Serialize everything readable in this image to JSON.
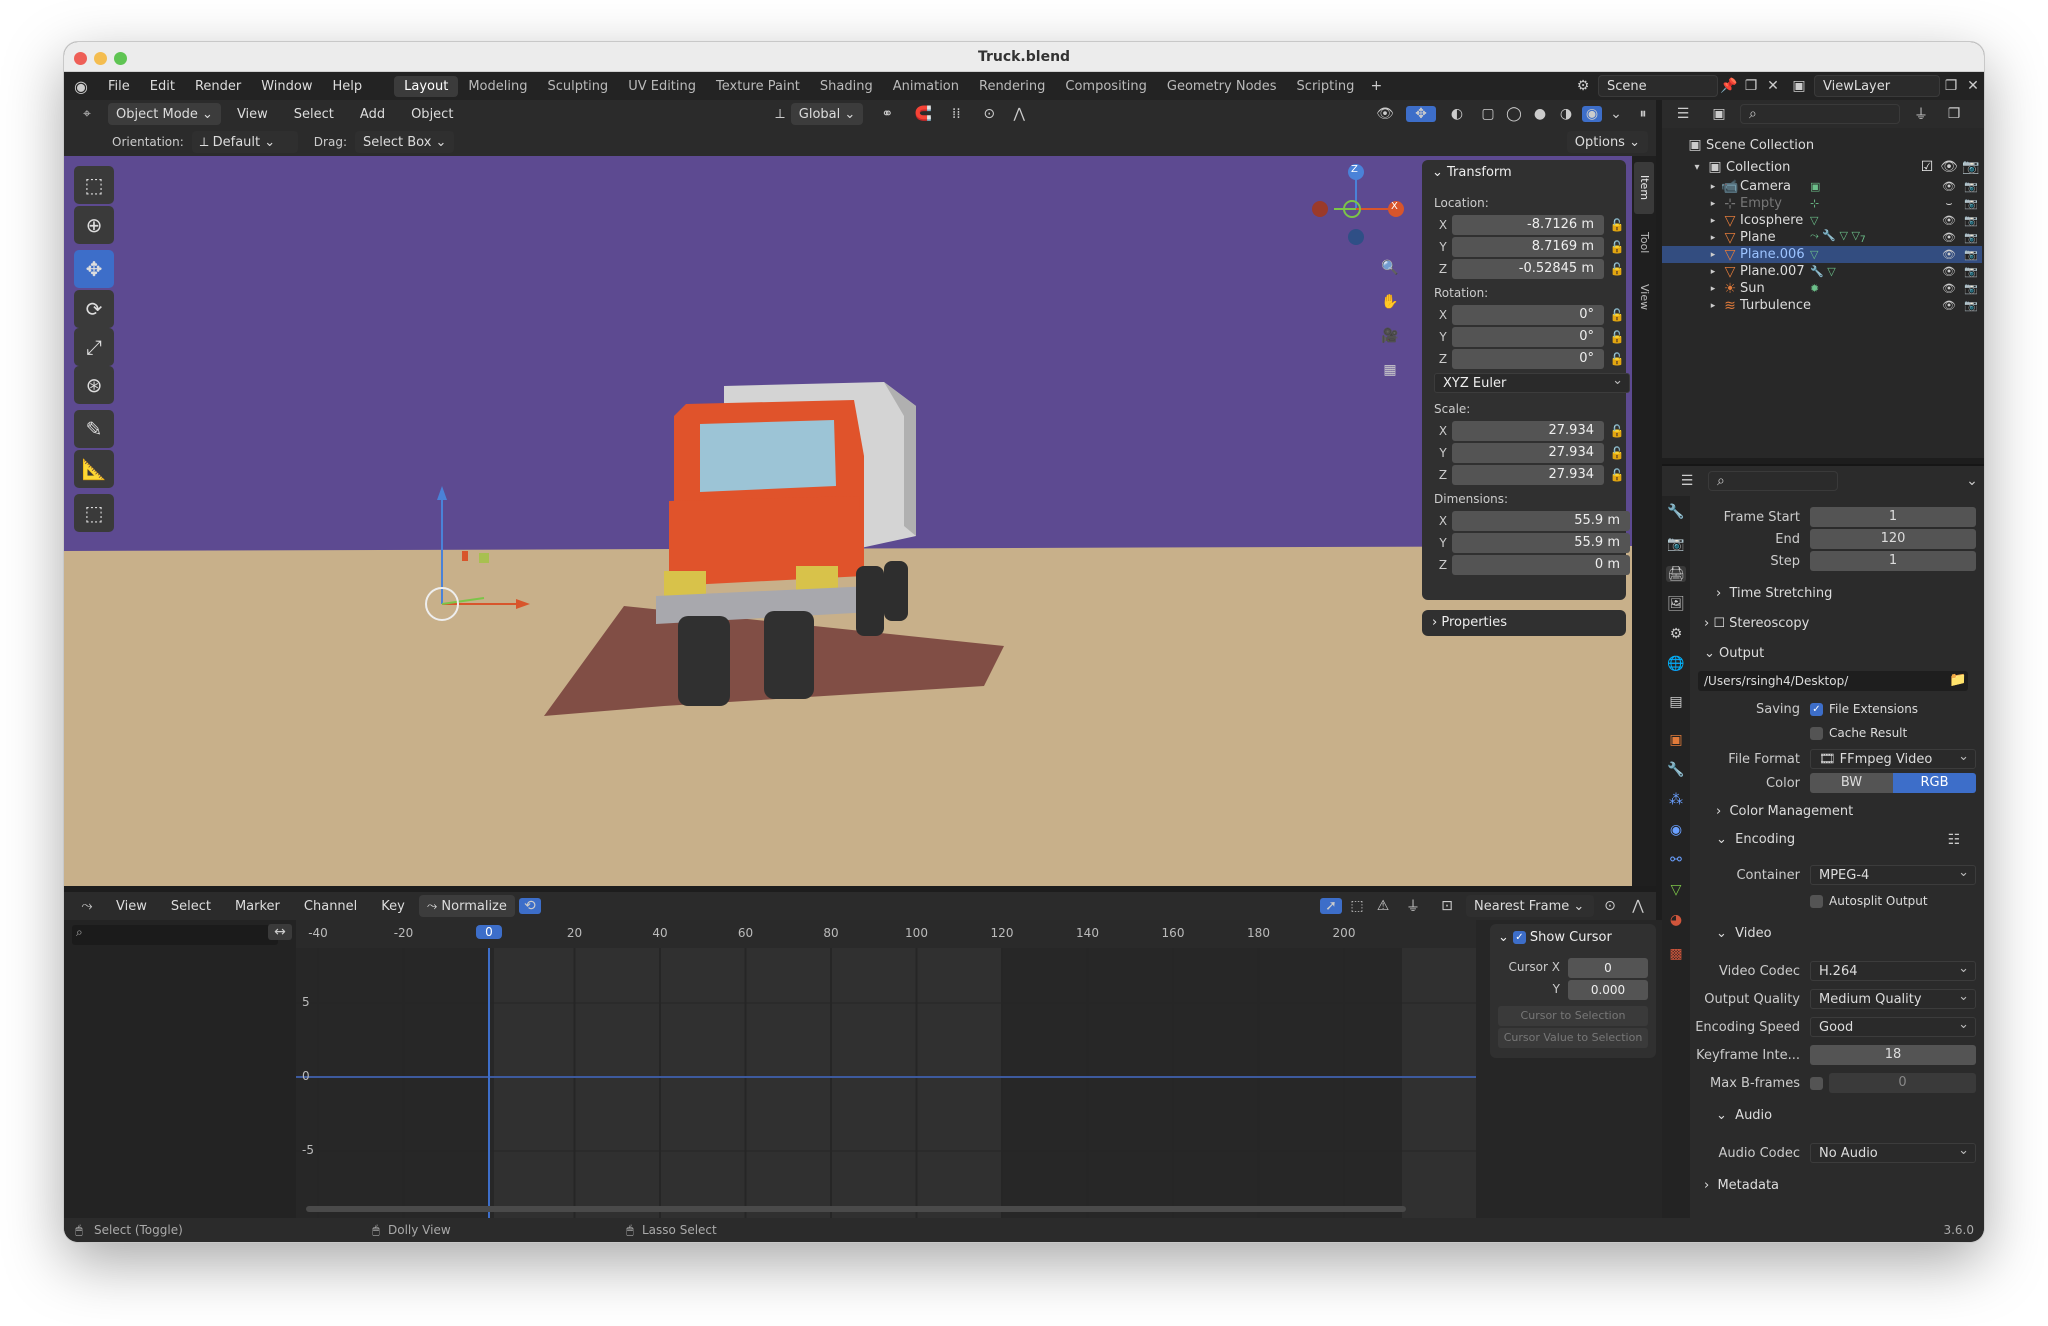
{
  "window": {
    "title": "Truck.blend"
  },
  "menu": [
    "File",
    "Edit",
    "Render",
    "Window",
    "Help"
  ],
  "workspaces": [
    "Layout",
    "Modeling",
    "Sculpting",
    "UV Editing",
    "Texture Paint",
    "Shading",
    "Animation",
    "Rendering",
    "Compositing",
    "Geometry Nodes",
    "Scripting"
  ],
  "active_workspace": "Layout",
  "scene": {
    "scene_name": "Scene",
    "view_layer": "ViewLayer"
  },
  "viewport_header": {
    "mode": "Object Mode",
    "menus": [
      "View",
      "Select",
      "Add",
      "Object"
    ],
    "transform_orientation": "Global",
    "orientation_label": "Orientation:",
    "orientation_value": "Default",
    "drag_label": "Drag:",
    "drag_value": "Select Box",
    "options": "Options"
  },
  "sidebar_tabs": [
    "Item",
    "Tool",
    "View"
  ],
  "transform_panel": {
    "title": "Transform",
    "location_label": "Location:",
    "location": [
      {
        "axis": "X",
        "value": "-8.7126 m"
      },
      {
        "axis": "Y",
        "value": "8.7169 m"
      },
      {
        "axis": "Z",
        "value": "-0.52845 m"
      }
    ],
    "rotation_label": "Rotation:",
    "rotation": [
      {
        "axis": "X",
        "value": "0°"
      },
      {
        "axis": "Y",
        "value": "0°"
      },
      {
        "axis": "Z",
        "value": "0°"
      }
    ],
    "rotation_mode": "XYZ Euler",
    "scale_label": "Scale:",
    "scale": [
      {
        "axis": "X",
        "value": "27.934"
      },
      {
        "axis": "Y",
        "value": "27.934"
      },
      {
        "axis": "Z",
        "value": "27.934"
      }
    ],
    "dimensions_label": "Dimensions:",
    "dimensions": [
      {
        "axis": "X",
        "value": "55.9 m"
      },
      {
        "axis": "Y",
        "value": "55.9 m"
      },
      {
        "axis": "Z",
        "value": "0 m"
      }
    ],
    "properties_title": "Properties"
  },
  "gizmo": {
    "x": "X",
    "y": "Y",
    "z": "Z"
  },
  "outliner": {
    "root": "Scene Collection",
    "collection": "Collection",
    "items": [
      {
        "name": "Camera",
        "color": "#e0773f"
      },
      {
        "name": "Empty",
        "color": "#777777"
      },
      {
        "name": "Icosphere",
        "color": "#e07a3a"
      },
      {
        "name": "Plane",
        "color": "#e07a3a"
      },
      {
        "name": "Plane.006",
        "color": "#e07a3a"
      },
      {
        "name": "Plane.007",
        "color": "#e07a3a"
      },
      {
        "name": "Sun",
        "color": "#e07a3a"
      },
      {
        "name": "Turbulence",
        "color": "#e07a3a"
      }
    ],
    "selected": "Plane.006",
    "plane_badge": "7"
  },
  "properties": {
    "frame_start_label": "Frame Start",
    "frame_start": "1",
    "end_label": "End",
    "end": "120",
    "step_label": "Step",
    "step": "1",
    "time_stretching": "Time Stretching",
    "stereoscopy": "Stereoscopy",
    "output": "Output",
    "path": "/Users/rsingh4/Desktop/",
    "saving_label": "Saving",
    "file_extensions": "File Extensions",
    "cache_result": "Cache Result",
    "file_format_label": "File Format",
    "file_format": "FFmpeg Video",
    "color_label": "Color",
    "color_bw": "BW",
    "color_rgb": "RGB",
    "color_management": "Color Management",
    "encoding": "Encoding",
    "container_label": "Container",
    "container": "MPEG-4",
    "autosplit": "Autosplit Output",
    "video": "Video",
    "video_codec_label": "Video Codec",
    "video_codec": "H.264",
    "output_quality_label": "Output Quality",
    "output_quality": "Medium Quality",
    "encoding_speed_label": "Encoding Speed",
    "encoding_speed": "Good",
    "keyframe_label": "Keyframe Inte...",
    "keyframe": "18",
    "max_bframes_label": "Max B-frames",
    "max_bframes": "0",
    "audio": "Audio",
    "audio_codec_label": "Audio Codec",
    "audio_codec": "No Audio",
    "metadata": "Metadata"
  },
  "graph_editor": {
    "menus": [
      "View",
      "Select",
      "Marker",
      "Channel",
      "Key"
    ],
    "normalize": "Normalize",
    "snap": "Nearest Frame",
    "frame_ticks": [
      "-40",
      "-20",
      "0",
      "20",
      "40",
      "60",
      "80",
      "100",
      "120",
      "140",
      "160",
      "180",
      "200"
    ],
    "value_ticks": [
      "5",
      "0",
      "-5"
    ],
    "current_frame": "0",
    "show_cursor": "Show Cursor",
    "cursor_x_label": "Cursor X",
    "cursor_x": "0",
    "cursor_y_label": "Y",
    "cursor_y": "0.000",
    "cursor_to_selection": "Cursor to Selection",
    "cursor_value_to_selection": "Cursor Value to Selection"
  },
  "statusbar": {
    "items": [
      "Select (Toggle)",
      "Dolly View",
      "Lasso Select"
    ],
    "version": "3.6.0"
  }
}
